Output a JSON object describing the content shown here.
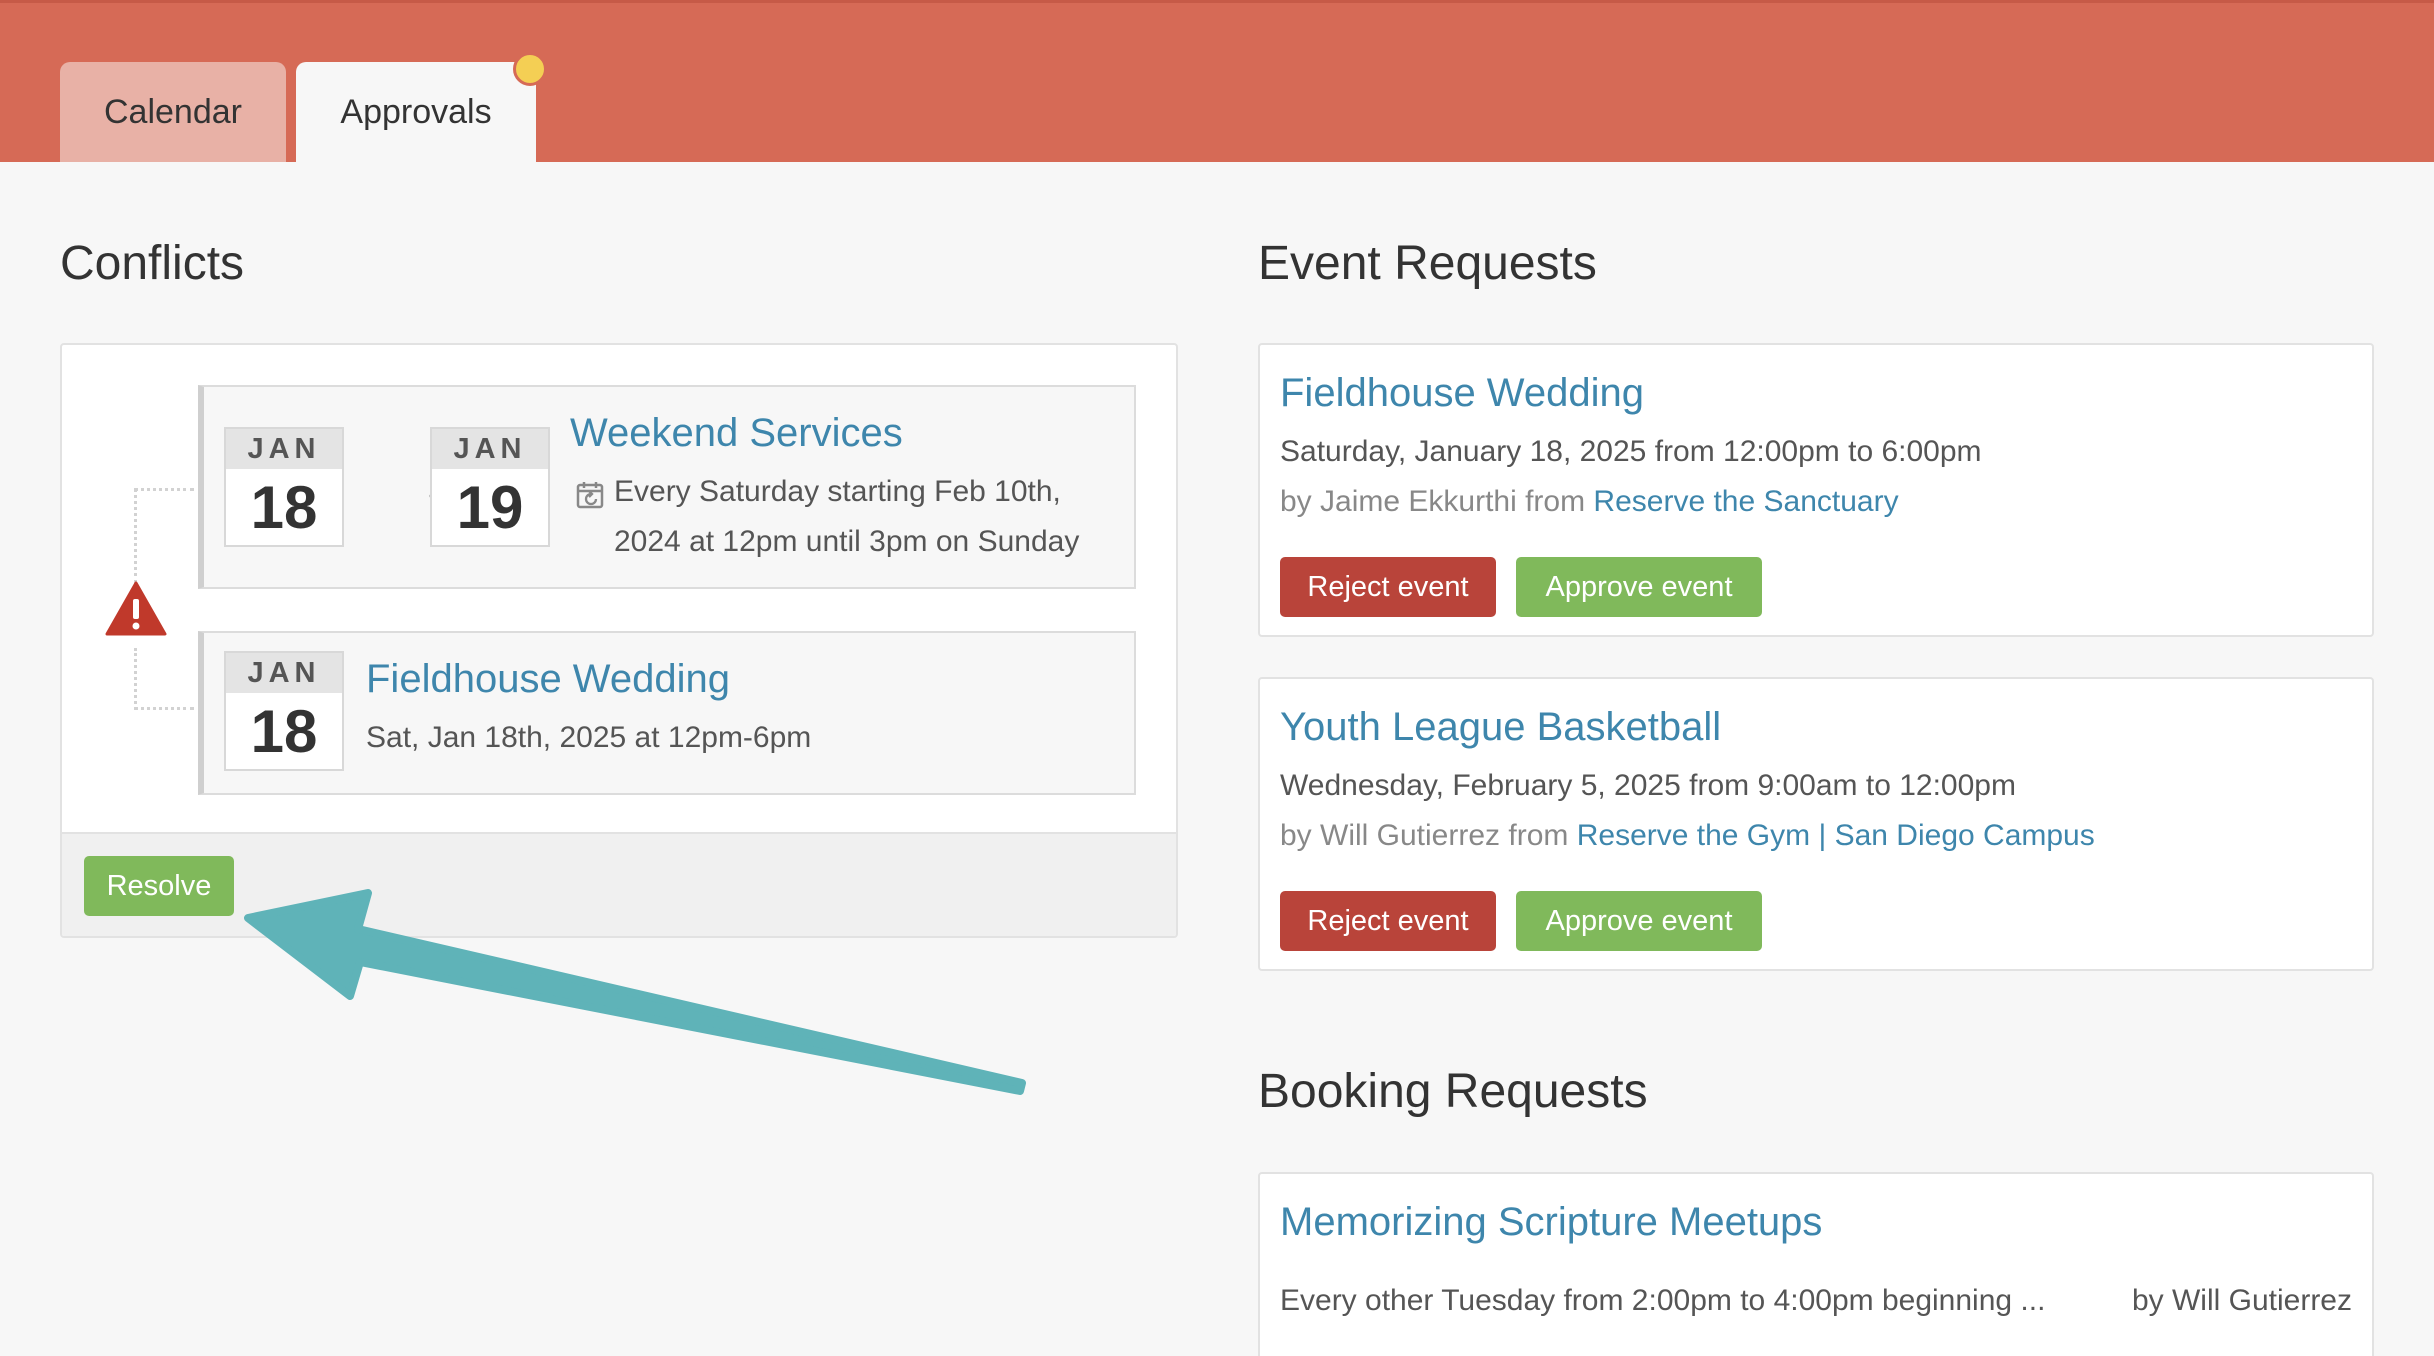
{
  "tabs": [
    {
      "label": "Calendar",
      "active": false
    },
    {
      "label": "Approvals",
      "active": true,
      "has_notification": true
    }
  ],
  "conflicts": {
    "title": "Conflicts",
    "items": [
      {
        "start_month": "JAN",
        "start_day": "18",
        "end_month": "JAN",
        "end_day": "19",
        "title": "Weekend Services",
        "recurrence_line1": "Every Saturday starting Feb 10th,",
        "recurrence_line2": "2024 at 12pm until 3pm on Sunday"
      },
      {
        "month": "JAN",
        "day": "18",
        "title": "Fieldhouse Wedding",
        "detail": "Sat, Jan 18th, 2025 at 12pm-6pm"
      }
    ],
    "resolve_label": "Resolve"
  },
  "event_requests": {
    "title": "Event Requests",
    "items": [
      {
        "title": "Fieldhouse Wedding",
        "when": "Saturday, January 18, 2025 from 12:00pm to 6:00pm",
        "by_prefix": "by Jaime Ekkurthi from ",
        "source": "Reserve the Sanctuary",
        "reject_label": "Reject event",
        "approve_label": "Approve event"
      },
      {
        "title": "Youth League Basketball",
        "when": "Wednesday, February 5, 2025 from 9:00am to 12:00pm",
        "by_prefix": "by Will Gutierrez from ",
        "source": "Reserve the Gym | San Diego Campus",
        "reject_label": "Reject event",
        "approve_label": "Approve event"
      }
    ]
  },
  "booking_requests": {
    "title": "Booking Requests",
    "items": [
      {
        "title": "Memorizing Scripture Meetups",
        "when": "Every other Tuesday from 2:00pm to 4:00pm beginning ...",
        "by": "by Will Gutierrez"
      }
    ]
  },
  "colors": {
    "header": "#d66a56",
    "link": "#3e86ac",
    "approve": "#80b95b",
    "reject": "#b9443a",
    "annotation_arrow": "#5fb3b8",
    "warning": "#c0392b",
    "notification_dot": "#f4cf54"
  },
  "icons": [
    "arrow-right-icon",
    "recurring-calendar-icon",
    "warning-icon",
    "annotation-arrow"
  ]
}
